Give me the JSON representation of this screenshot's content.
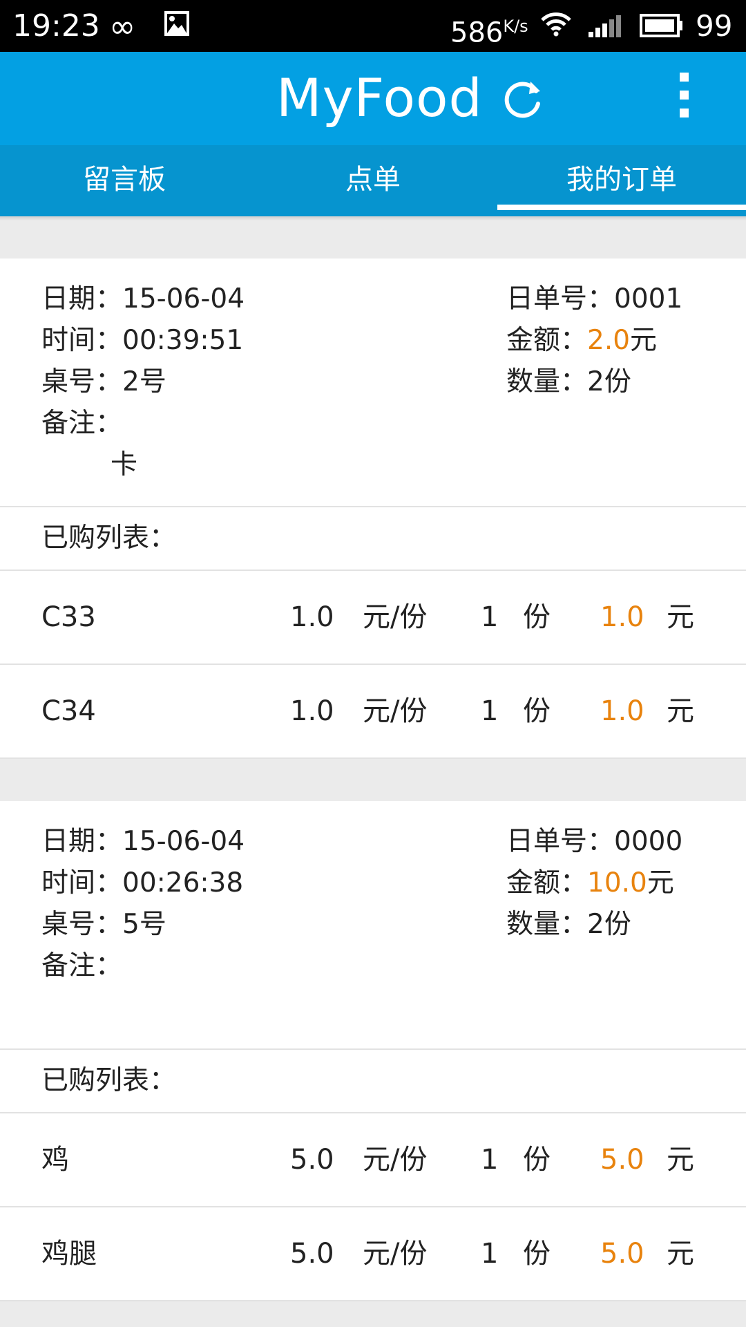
{
  "status_bar": {
    "time": "19:23",
    "speed": "586",
    "speed_unit": "K/s",
    "battery": "99"
  },
  "app_bar": {
    "title": "MyFood",
    "icons": [
      "refresh-icon",
      "overflow-menu-icon"
    ]
  },
  "tabs": [
    {
      "label": "留言板",
      "active": false
    },
    {
      "label": "点单",
      "active": false
    },
    {
      "label": "我的订单",
      "active": true
    }
  ],
  "colors": {
    "app_bar": "#03a0e3",
    "tab_bar": "#0694cf",
    "accent_amount": "#e8830e",
    "background": "#ebebeb"
  },
  "orders": [
    {
      "date_label": "日期：",
      "date": "15-06-04",
      "time_label": "时间：",
      "time": "00:39:51",
      "table_label": "桌号：",
      "table": "2号",
      "note_label": "备注：",
      "note": "卡",
      "order_no_label": "日单号：",
      "order_no": "0001",
      "amount_label": "金额：",
      "amount": "2.0",
      "amount_unit": "元",
      "count_label": "数量：",
      "count": "2份",
      "purchased_label": "已购列表：",
      "items": [
        {
          "name": "C33",
          "price": "1.0",
          "price_unit": "元/份",
          "qty": "1",
          "qty_unit": "份",
          "total": "1.0",
          "currency": "元"
        },
        {
          "name": "C34",
          "price": "1.0",
          "price_unit": "元/份",
          "qty": "1",
          "qty_unit": "份",
          "total": "1.0",
          "currency": "元"
        }
      ]
    },
    {
      "date_label": "日期：",
      "date": "15-06-04",
      "time_label": "时间：",
      "time": "00:26:38",
      "table_label": "桌号：",
      "table": "5号",
      "note_label": "备注：",
      "note": "",
      "order_no_label": "日单号：",
      "order_no": "0000",
      "amount_label": "金额：",
      "amount": "10.0",
      "amount_unit": "元",
      "count_label": "数量：",
      "count": "2份",
      "purchased_label": "已购列表：",
      "items": [
        {
          "name": "鸡",
          "price": "5.0",
          "price_unit": "元/份",
          "qty": "1",
          "qty_unit": "份",
          "total": "5.0",
          "currency": "元"
        },
        {
          "name": "鸡腿",
          "price": "5.0",
          "price_unit": "元/份",
          "qty": "1",
          "qty_unit": "份",
          "total": "5.0",
          "currency": "元"
        }
      ]
    }
  ]
}
